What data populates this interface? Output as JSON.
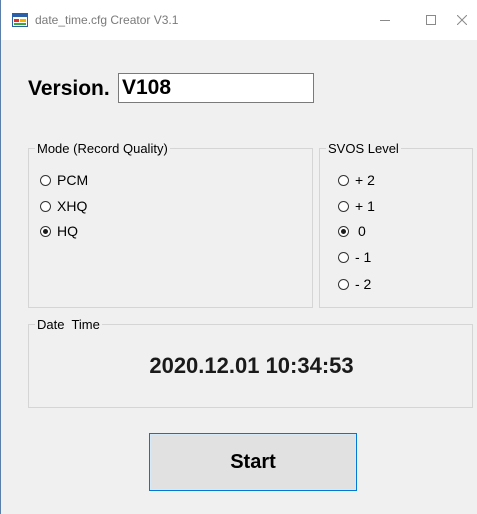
{
  "window": {
    "title": "date_time.cfg Creator V3.1",
    "icon": "app-window-icon",
    "controls": [
      "minimize-icon",
      "maximize-icon",
      "close-icon"
    ]
  },
  "version": {
    "label": "Version.",
    "value": "V108"
  },
  "mode_group": {
    "caption": "Mode (Record Quality)",
    "options": [
      {
        "label": "PCM",
        "checked": false
      },
      {
        "label": "XHQ",
        "checked": false
      },
      {
        "label": "HQ",
        "checked": true
      }
    ]
  },
  "svos_group": {
    "caption": "SVOS Level",
    "options": [
      {
        "label": "+ 2",
        "checked": false
      },
      {
        "label": "+ 1",
        "checked": false
      },
      {
        "label": "0",
        "checked": true
      },
      {
        "label": "- 1",
        "checked": false
      },
      {
        "label": "- 2",
        "checked": false
      }
    ]
  },
  "date_time": {
    "caption": "Date  Time",
    "value": "2020.12.01 10:34:53"
  },
  "actions": {
    "start_label": "Start",
    "accent_color": "#0078d7"
  }
}
